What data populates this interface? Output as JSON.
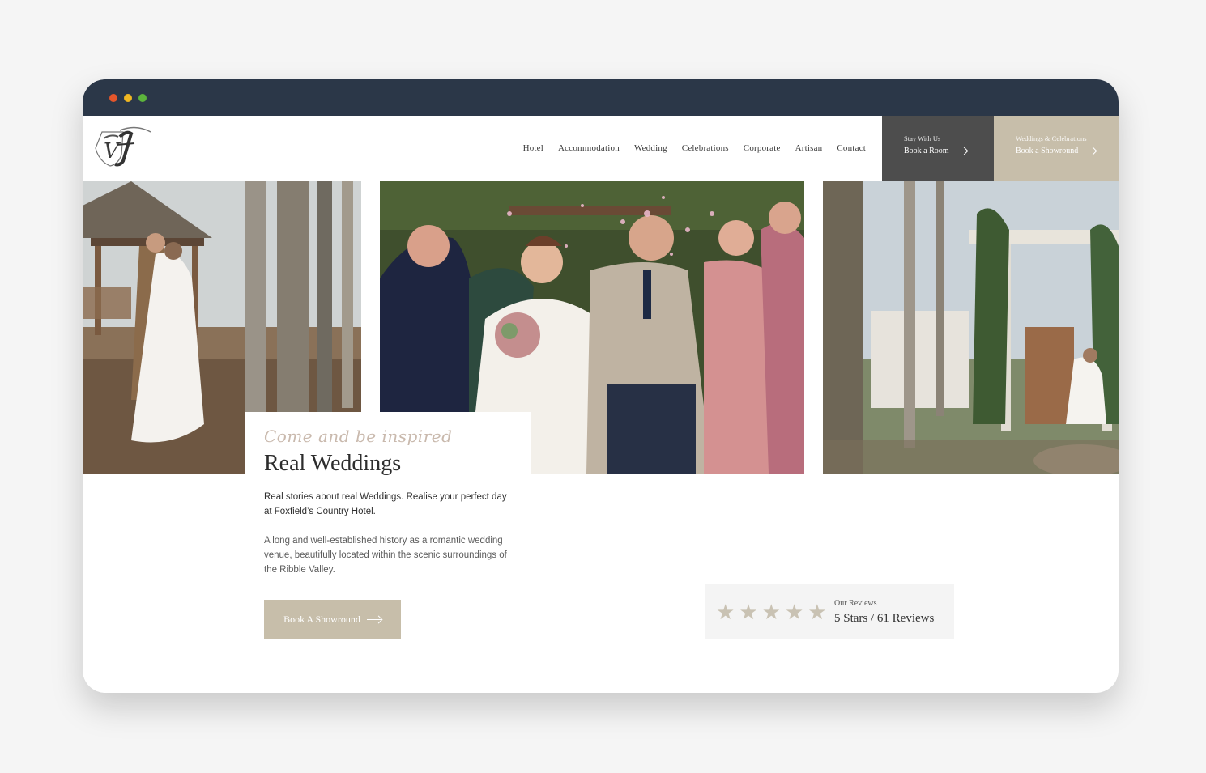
{
  "header": {
    "nav": [
      "Hotel",
      "Accommodation",
      "Wedding",
      "Celebrations",
      "Corporate",
      "Artisan",
      "Contact"
    ],
    "cta_stay": {
      "small": "Stay With Us",
      "big": "Book a Room"
    },
    "cta_weddings": {
      "small": "Weddings & Celebrations",
      "big": "Book a Showround"
    }
  },
  "hero": {
    "script": "Come and be inspired",
    "title": "Real Weddings",
    "lead": "Real stories about real Weddings. Realise your perfect day at Foxfield’s Country Hotel.",
    "body": "A long and well-established history as a romantic wedding venue, beautifully located within the scenic surroundings of the Ribble Valley.",
    "button": "Book A Showround"
  },
  "reviews": {
    "rating": 5,
    "label": "Our Reviews",
    "value": "5 Stars / 61 Reviews"
  },
  "colors": {
    "chrome": "#2b3748",
    "accent": "#c7beaa",
    "dark_cta": "#4d4d4d"
  },
  "icons": [
    "logo-monogram",
    "arrow-right-icon",
    "star-icon"
  ]
}
